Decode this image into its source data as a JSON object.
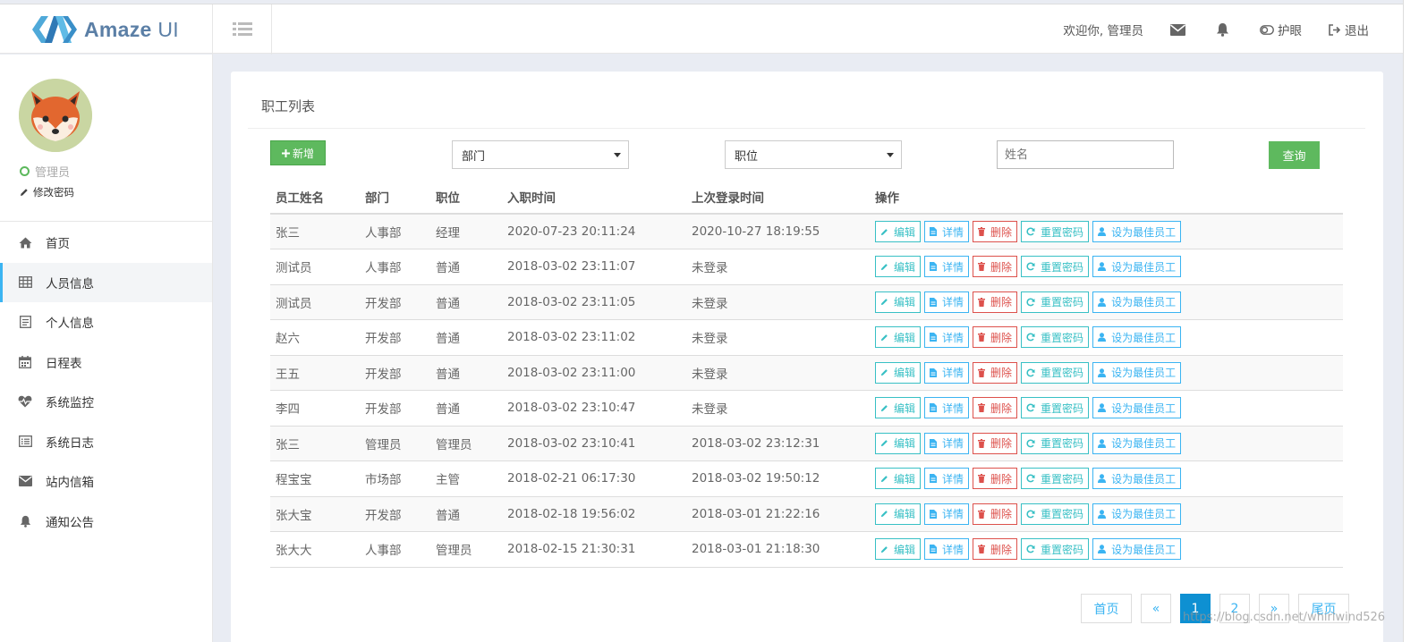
{
  "header": {
    "logo_text_a": "Amaze",
    "logo_text_b": " UI",
    "welcome": "欢迎你, 管理员",
    "eye_label": "护眼",
    "logout_label": "退出"
  },
  "sidebar": {
    "role": "管理员",
    "change_pwd": "修改密码",
    "items": [
      {
        "label": "首页",
        "icon": "home-icon"
      },
      {
        "label": "人员信息",
        "icon": "table-icon"
      },
      {
        "label": "个人信息",
        "icon": "file-icon"
      },
      {
        "label": "日程表",
        "icon": "calendar-icon"
      },
      {
        "label": "系统监控",
        "icon": "heartbeat-icon"
      },
      {
        "label": "系统日志",
        "icon": "list-icon"
      },
      {
        "label": "站内信箱",
        "icon": "envelope-icon"
      },
      {
        "label": "通知公告",
        "icon": "bell-icon"
      }
    ]
  },
  "main": {
    "title": "职工列表",
    "add_label": "新增",
    "dept_select": "部门",
    "position_select": "职位",
    "name_placeholder": "姓名",
    "query_label": "查询"
  },
  "table": {
    "headers": [
      "员工姓名",
      "部门",
      "职位",
      "入职时间",
      "上次登录时间",
      "操作"
    ],
    "actions": {
      "edit": "编辑",
      "detail": "详情",
      "delete": "删除",
      "reset": "重置密码",
      "best": "设为最佳员工"
    },
    "rows": [
      [
        "张三",
        "人事部",
        "经理",
        "2020-07-23 20:11:24",
        "2020-10-27 18:19:55"
      ],
      [
        "测试员",
        "人事部",
        "普通",
        "2018-03-02 23:11:07",
        "未登录"
      ],
      [
        "测试员",
        "开发部",
        "普通",
        "2018-03-02 23:11:05",
        "未登录"
      ],
      [
        "赵六",
        "开发部",
        "普通",
        "2018-03-02 23:11:02",
        "未登录"
      ],
      [
        "王五",
        "开发部",
        "普通",
        "2018-03-02 23:11:00",
        "未登录"
      ],
      [
        "李四",
        "开发部",
        "普通",
        "2018-03-02 23:10:47",
        "未登录"
      ],
      [
        "张三",
        "管理员",
        "管理员",
        "2018-03-02 23:10:41",
        "2018-03-02 23:12:31"
      ],
      [
        "程宝宝",
        "市场部",
        "主管",
        "2018-02-21 06:17:30",
        "2018-03-02 19:50:12"
      ],
      [
        "张大宝",
        "开发部",
        "普通",
        "2018-02-18 19:56:02",
        "2018-03-01 21:22:16"
      ],
      [
        "张大大",
        "人事部",
        "管理员",
        "2018-02-15 21:30:31",
        "2018-03-01 21:18:30"
      ]
    ]
  },
  "pager": {
    "first": "首页",
    "prev": "«",
    "pages": [
      "1",
      "2"
    ],
    "next": "»",
    "last": "尾页"
  },
  "watermark": "https://blog.csdn.net/whirlwind526"
}
